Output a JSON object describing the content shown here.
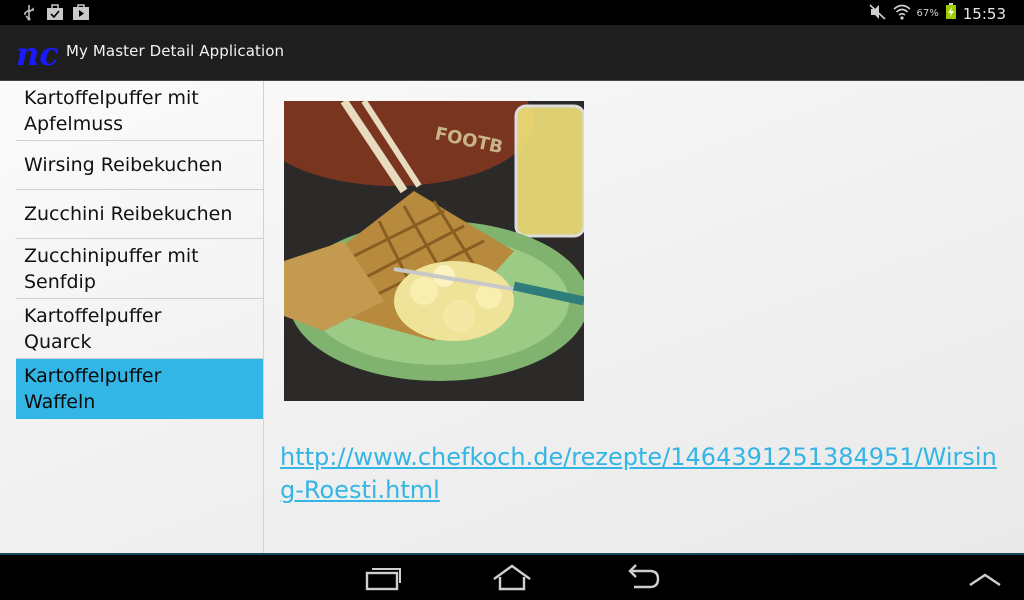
{
  "statusbar": {
    "icons_left": [
      "usb-icon",
      "briefcase-icon",
      "play-store-icon"
    ],
    "battery_percent": "67%",
    "clock": "15:53"
  },
  "actionbar": {
    "title": "My Master Detail Application"
  },
  "list": {
    "items": [
      {
        "line1": "Kartoffelpuffer mit",
        "line2": "Apfelmuss"
      },
      {
        "line1": "Wirsing Reibekuchen",
        "line2": ""
      },
      {
        "line1": "Zucchini Reibekuchen",
        "line2": ""
      },
      {
        "line1": "Zucchinipuffer mit",
        "line2": "Senfdip"
      },
      {
        "line1": "Kartoffelpuffer",
        "line2": "Quarck"
      },
      {
        "line1": "Kartoffelpuffer",
        "line2": "Waffeln"
      }
    ]
  },
  "detail": {
    "link_url": "http://www.chefkoch.de/rezepte/1464391251384951/Wirsing-Roesti.html"
  },
  "colors": {
    "accent": "#33b5e5",
    "actionbar": "#1e1e1e"
  }
}
